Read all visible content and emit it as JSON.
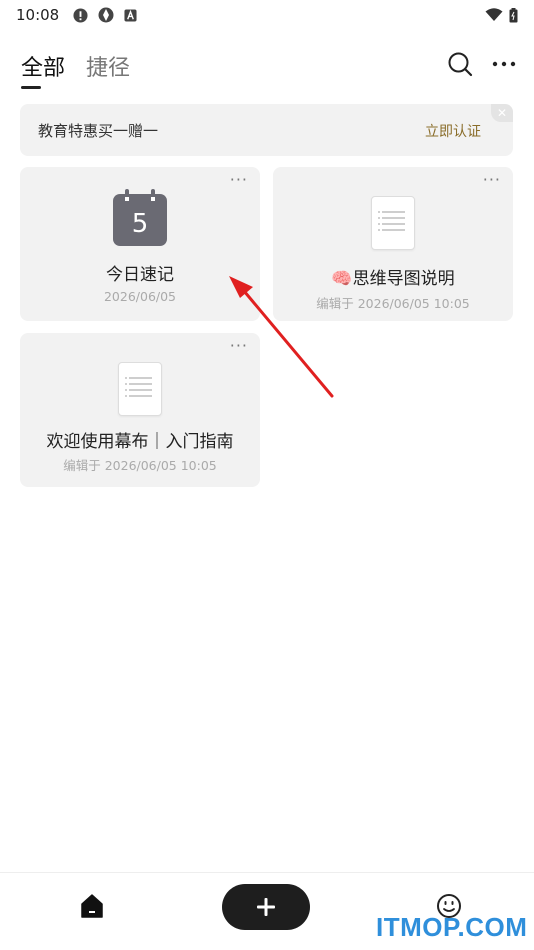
{
  "status_bar": {
    "time": "10:08"
  },
  "header": {
    "tabs": [
      {
        "label": "全部",
        "active": true
      },
      {
        "label": "捷径",
        "active": false
      }
    ]
  },
  "banner": {
    "text": "教育特惠买一赠一",
    "action": "立即认证"
  },
  "cards": [
    {
      "icon": "calendar-icon",
      "calendar_day": "5",
      "title": "今日速记",
      "meta": "2026/06/05"
    },
    {
      "icon": "document-icon",
      "title": "🧠思维导图说明",
      "meta": "编辑于 2026/06/05 10:05"
    },
    {
      "icon": "document-icon",
      "title": "欢迎使用幕布｜入门指南",
      "meta": "编辑于 2026/06/05 10:05"
    }
  ],
  "watermark": "ITMOP.COM",
  "colors": {
    "card_bg": "#f2f2f2",
    "banner_link": "#8a6d2a",
    "annotation_arrow": "#e02020",
    "watermark": "#2f8fdb",
    "add_button": "#1e1e1e"
  }
}
